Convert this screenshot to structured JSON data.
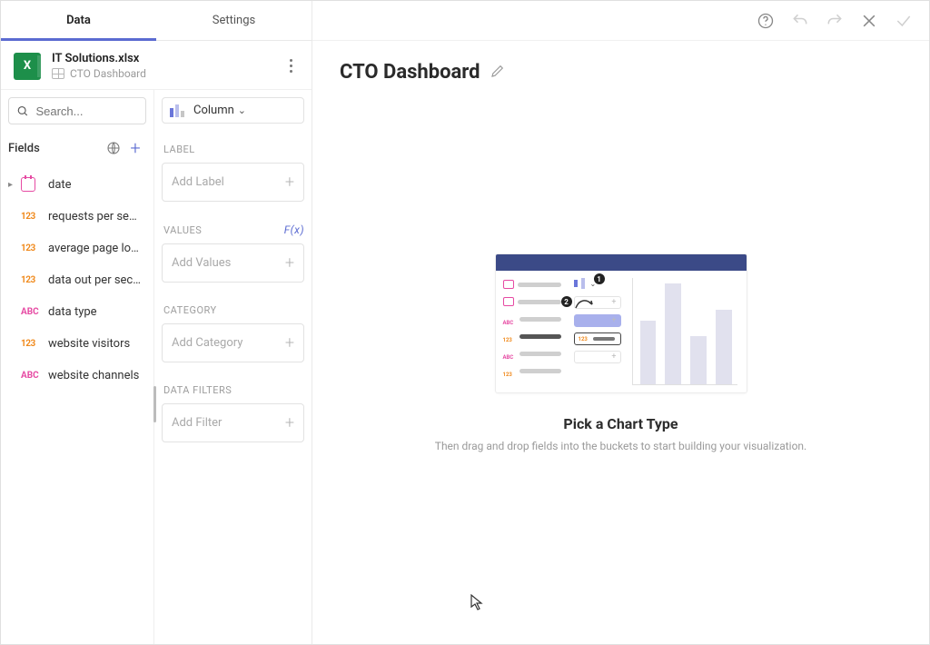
{
  "tabs": {
    "data": "Data",
    "settings": "Settings"
  },
  "file": {
    "icon_text": "X",
    "name": "IT Solutions.xlsx",
    "sheet": "CTO Dashboard"
  },
  "search": {
    "placeholder": "Search..."
  },
  "fields_header": "Fields",
  "fields": [
    {
      "type": "date",
      "label": "date",
      "expandable": true
    },
    {
      "type": "123",
      "label": "requests per se…"
    },
    {
      "type": "123",
      "label": "average page lo…"
    },
    {
      "type": "123",
      "label": "data out per sec…"
    },
    {
      "type": "abc",
      "label": "data type"
    },
    {
      "type": "123",
      "label": "website visitors"
    },
    {
      "type": "abc",
      "label": "website channels"
    }
  ],
  "chart_picker": {
    "label": "Column"
  },
  "sections": {
    "label": {
      "title": "LABEL",
      "placeholder": "Add Label"
    },
    "values": {
      "title": "VALUES",
      "fx": "F(x)",
      "placeholder": "Add Values"
    },
    "category": {
      "title": "CATEGORY",
      "placeholder": "Add Category"
    },
    "filters": {
      "title": "DATA FILTERS",
      "placeholder": "Add Filter"
    }
  },
  "dashboard": {
    "title": "CTO Dashboard",
    "pick_title": "Pick a Chart Type",
    "pick_sub": "Then drag and drop fields into the buckets to start building your visualization."
  }
}
